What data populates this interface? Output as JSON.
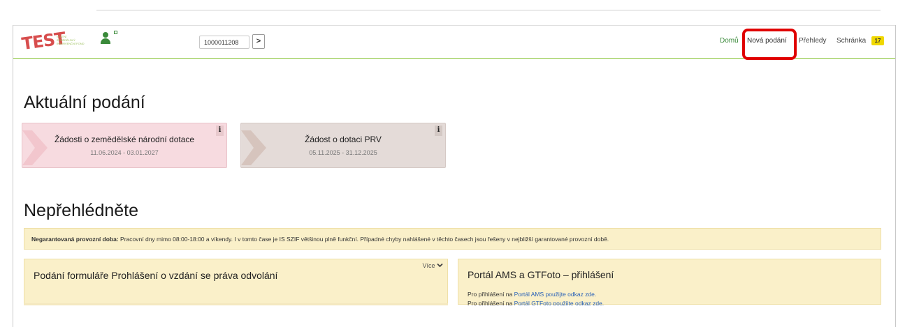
{
  "header": {
    "logo_text": "TEST",
    "logo_sub": "STÁTNÍ ZEMĚDĚLSKÝ INTERVENČNÍ FOND",
    "client_id": "1000011208",
    "go_label": ">",
    "nav": {
      "home": "Domů",
      "new": "Nová podání",
      "overview": "Přehledy",
      "inbox": "Schránka",
      "inbox_count": "17"
    }
  },
  "current": {
    "title": "Aktuální podání",
    "cards": [
      {
        "title": "Žádosti o zemědělské národní dotace",
        "dates": "11.06.2024 - 03.01.2027",
        "info": "i"
      },
      {
        "title": "Žádost o dotaci PRV",
        "dates": "05.11.2025 - 31.12.2025",
        "info": "i"
      }
    ]
  },
  "dontmiss": {
    "title": "Nepřehlédněte",
    "notice_bold": "Negarantovaná provozní doba:",
    "notice_text": " Pracovní dny mimo 08:00-18:00 a víkendy. I v tomto čase je IS SZIF většinou plně funkční. Případné chyby nahlášené v těchto časech jsou řešeny v nejbližší garantované provozní době.",
    "panels": [
      {
        "title": "Podání formuláře Prohlášení o vzdání se práva odvolání",
        "more": "Více"
      },
      {
        "title": "Portál AMS a GTFoto – přihlášení",
        "line1_pre": "Pro přihlášení na ",
        "line1_link": "Portál AMS použijte odkaz zde.",
        "line2_pre": "Pro přihlášení na ",
        "line2_link": "Portál GTFoto použijte odkaz zde."
      }
    ]
  }
}
